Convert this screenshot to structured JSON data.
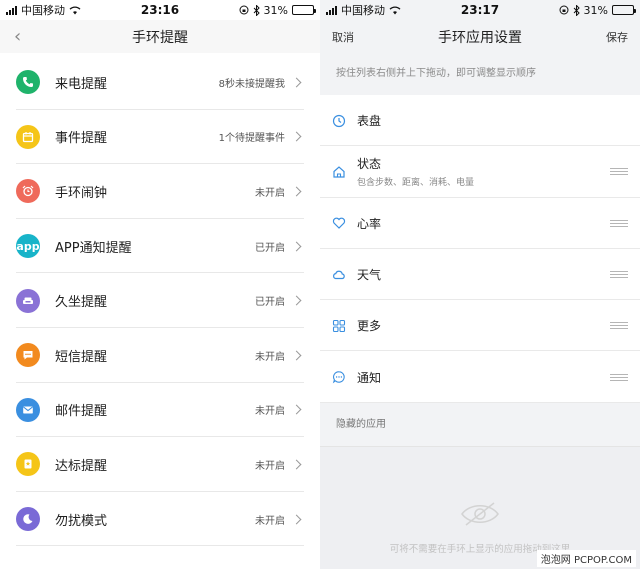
{
  "left": {
    "status": {
      "carrier": "中国移动",
      "time": "23:16",
      "battery": "31%",
      "battery_level": 0.31
    },
    "nav": {
      "title": "手环提醒",
      "back_icon": "chevron-left-icon"
    },
    "items": [
      {
        "label": "来电提醒",
        "value": "8秒未接提醒我",
        "icon": "phone-icon",
        "color": "#1fb36b"
      },
      {
        "label": "事件提醒",
        "value": "1个待提醒事件",
        "icon": "calendar-icon",
        "color": "#f5c518"
      },
      {
        "label": "手环闹钟",
        "value": "未开启",
        "icon": "alarm-clock-icon",
        "color": "#ef6a5b"
      },
      {
        "label": "APP通知提醒",
        "value": "已开启",
        "icon": "app-icon",
        "color": "#18b4c9"
      },
      {
        "label": "久坐提醒",
        "value": "已开启",
        "icon": "sofa-icon",
        "color": "#8a72d6"
      },
      {
        "label": "短信提醒",
        "value": "未开启",
        "icon": "message-icon",
        "color": "#f28a1e"
      },
      {
        "label": "邮件提醒",
        "value": "未开启",
        "icon": "mail-icon",
        "color": "#3a8fe0"
      },
      {
        "label": "达标提醒",
        "value": "未开启",
        "icon": "medal-icon",
        "color": "#f5c518"
      },
      {
        "label": "勿扰模式",
        "value": "未开启",
        "icon": "moon-icon",
        "color": "#7a6ad6"
      }
    ],
    "app_icon_text": "app"
  },
  "right": {
    "status": {
      "carrier": "中国移动",
      "time": "23:17",
      "battery": "31%",
      "battery_level": 0.31
    },
    "nav": {
      "title": "手环应用设置",
      "cancel": "取消",
      "save": "保存"
    },
    "hint": "按住列表右侧并上下拖动，即可调整显示顺序",
    "apps": [
      {
        "name": "表盘",
        "sub": "",
        "icon": "clock-icon",
        "draggable": false
      },
      {
        "name": "状态",
        "sub": "包含步数、距离、消耗、电量",
        "icon": "home-icon",
        "draggable": true
      },
      {
        "name": "心率",
        "sub": "",
        "icon": "heart-icon",
        "draggable": true
      },
      {
        "name": "天气",
        "sub": "",
        "icon": "cloud-icon",
        "draggable": true
      },
      {
        "name": "更多",
        "sub": "",
        "icon": "grid-icon",
        "draggable": true
      },
      {
        "name": "通知",
        "sub": "",
        "icon": "chat-icon",
        "draggable": true
      }
    ],
    "hidden_title": "隐藏的应用",
    "hidden_empty": "可将不需要在手环上显示的应用拖动到这里",
    "accent": "#3a8fe0"
  },
  "watermark": "泡泡网 PCPOP.COM"
}
